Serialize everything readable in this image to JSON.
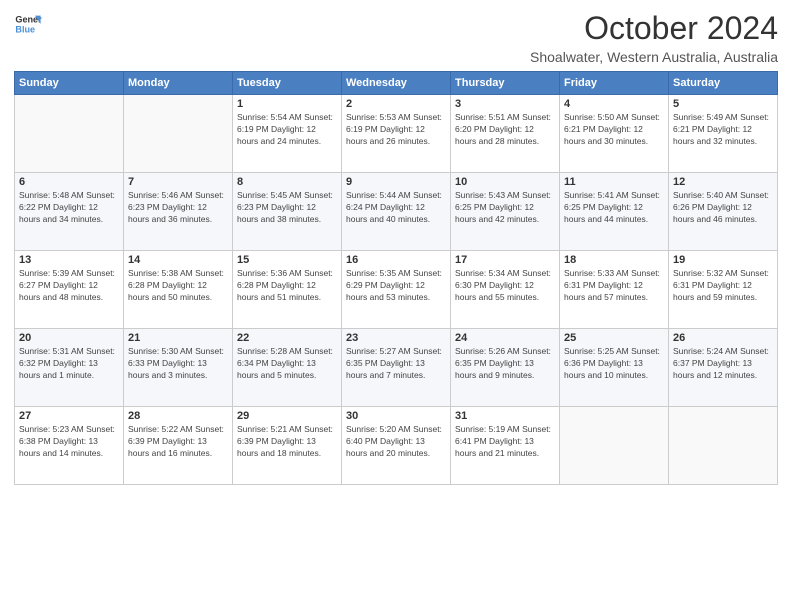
{
  "logo": {
    "line1": "General",
    "line2": "Blue"
  },
  "title": "October 2024",
  "subtitle": "Shoalwater, Western Australia, Australia",
  "days_of_week": [
    "Sunday",
    "Monday",
    "Tuesday",
    "Wednesday",
    "Thursday",
    "Friday",
    "Saturday"
  ],
  "weeks": [
    [
      {
        "day": "",
        "content": ""
      },
      {
        "day": "",
        "content": ""
      },
      {
        "day": "1",
        "content": "Sunrise: 5:54 AM\nSunset: 6:19 PM\nDaylight: 12 hours and 24 minutes."
      },
      {
        "day": "2",
        "content": "Sunrise: 5:53 AM\nSunset: 6:19 PM\nDaylight: 12 hours and 26 minutes."
      },
      {
        "day": "3",
        "content": "Sunrise: 5:51 AM\nSunset: 6:20 PM\nDaylight: 12 hours and 28 minutes."
      },
      {
        "day": "4",
        "content": "Sunrise: 5:50 AM\nSunset: 6:21 PM\nDaylight: 12 hours and 30 minutes."
      },
      {
        "day": "5",
        "content": "Sunrise: 5:49 AM\nSunset: 6:21 PM\nDaylight: 12 hours and 32 minutes."
      }
    ],
    [
      {
        "day": "6",
        "content": "Sunrise: 5:48 AM\nSunset: 6:22 PM\nDaylight: 12 hours and 34 minutes."
      },
      {
        "day": "7",
        "content": "Sunrise: 5:46 AM\nSunset: 6:23 PM\nDaylight: 12 hours and 36 minutes."
      },
      {
        "day": "8",
        "content": "Sunrise: 5:45 AM\nSunset: 6:23 PM\nDaylight: 12 hours and 38 minutes."
      },
      {
        "day": "9",
        "content": "Sunrise: 5:44 AM\nSunset: 6:24 PM\nDaylight: 12 hours and 40 minutes."
      },
      {
        "day": "10",
        "content": "Sunrise: 5:43 AM\nSunset: 6:25 PM\nDaylight: 12 hours and 42 minutes."
      },
      {
        "day": "11",
        "content": "Sunrise: 5:41 AM\nSunset: 6:25 PM\nDaylight: 12 hours and 44 minutes."
      },
      {
        "day": "12",
        "content": "Sunrise: 5:40 AM\nSunset: 6:26 PM\nDaylight: 12 hours and 46 minutes."
      }
    ],
    [
      {
        "day": "13",
        "content": "Sunrise: 5:39 AM\nSunset: 6:27 PM\nDaylight: 12 hours and 48 minutes."
      },
      {
        "day": "14",
        "content": "Sunrise: 5:38 AM\nSunset: 6:28 PM\nDaylight: 12 hours and 50 minutes."
      },
      {
        "day": "15",
        "content": "Sunrise: 5:36 AM\nSunset: 6:28 PM\nDaylight: 12 hours and 51 minutes."
      },
      {
        "day": "16",
        "content": "Sunrise: 5:35 AM\nSunset: 6:29 PM\nDaylight: 12 hours and 53 minutes."
      },
      {
        "day": "17",
        "content": "Sunrise: 5:34 AM\nSunset: 6:30 PM\nDaylight: 12 hours and 55 minutes."
      },
      {
        "day": "18",
        "content": "Sunrise: 5:33 AM\nSunset: 6:31 PM\nDaylight: 12 hours and 57 minutes."
      },
      {
        "day": "19",
        "content": "Sunrise: 5:32 AM\nSunset: 6:31 PM\nDaylight: 12 hours and 59 minutes."
      }
    ],
    [
      {
        "day": "20",
        "content": "Sunrise: 5:31 AM\nSunset: 6:32 PM\nDaylight: 13 hours and 1 minute."
      },
      {
        "day": "21",
        "content": "Sunrise: 5:30 AM\nSunset: 6:33 PM\nDaylight: 13 hours and 3 minutes."
      },
      {
        "day": "22",
        "content": "Sunrise: 5:28 AM\nSunset: 6:34 PM\nDaylight: 13 hours and 5 minutes."
      },
      {
        "day": "23",
        "content": "Sunrise: 5:27 AM\nSunset: 6:35 PM\nDaylight: 13 hours and 7 minutes."
      },
      {
        "day": "24",
        "content": "Sunrise: 5:26 AM\nSunset: 6:35 PM\nDaylight: 13 hours and 9 minutes."
      },
      {
        "day": "25",
        "content": "Sunrise: 5:25 AM\nSunset: 6:36 PM\nDaylight: 13 hours and 10 minutes."
      },
      {
        "day": "26",
        "content": "Sunrise: 5:24 AM\nSunset: 6:37 PM\nDaylight: 13 hours and 12 minutes."
      }
    ],
    [
      {
        "day": "27",
        "content": "Sunrise: 5:23 AM\nSunset: 6:38 PM\nDaylight: 13 hours and 14 minutes."
      },
      {
        "day": "28",
        "content": "Sunrise: 5:22 AM\nSunset: 6:39 PM\nDaylight: 13 hours and 16 minutes."
      },
      {
        "day": "29",
        "content": "Sunrise: 5:21 AM\nSunset: 6:39 PM\nDaylight: 13 hours and 18 minutes."
      },
      {
        "day": "30",
        "content": "Sunrise: 5:20 AM\nSunset: 6:40 PM\nDaylight: 13 hours and 20 minutes."
      },
      {
        "day": "31",
        "content": "Sunrise: 5:19 AM\nSunset: 6:41 PM\nDaylight: 13 hours and 21 minutes."
      },
      {
        "day": "",
        "content": ""
      },
      {
        "day": "",
        "content": ""
      }
    ]
  ]
}
